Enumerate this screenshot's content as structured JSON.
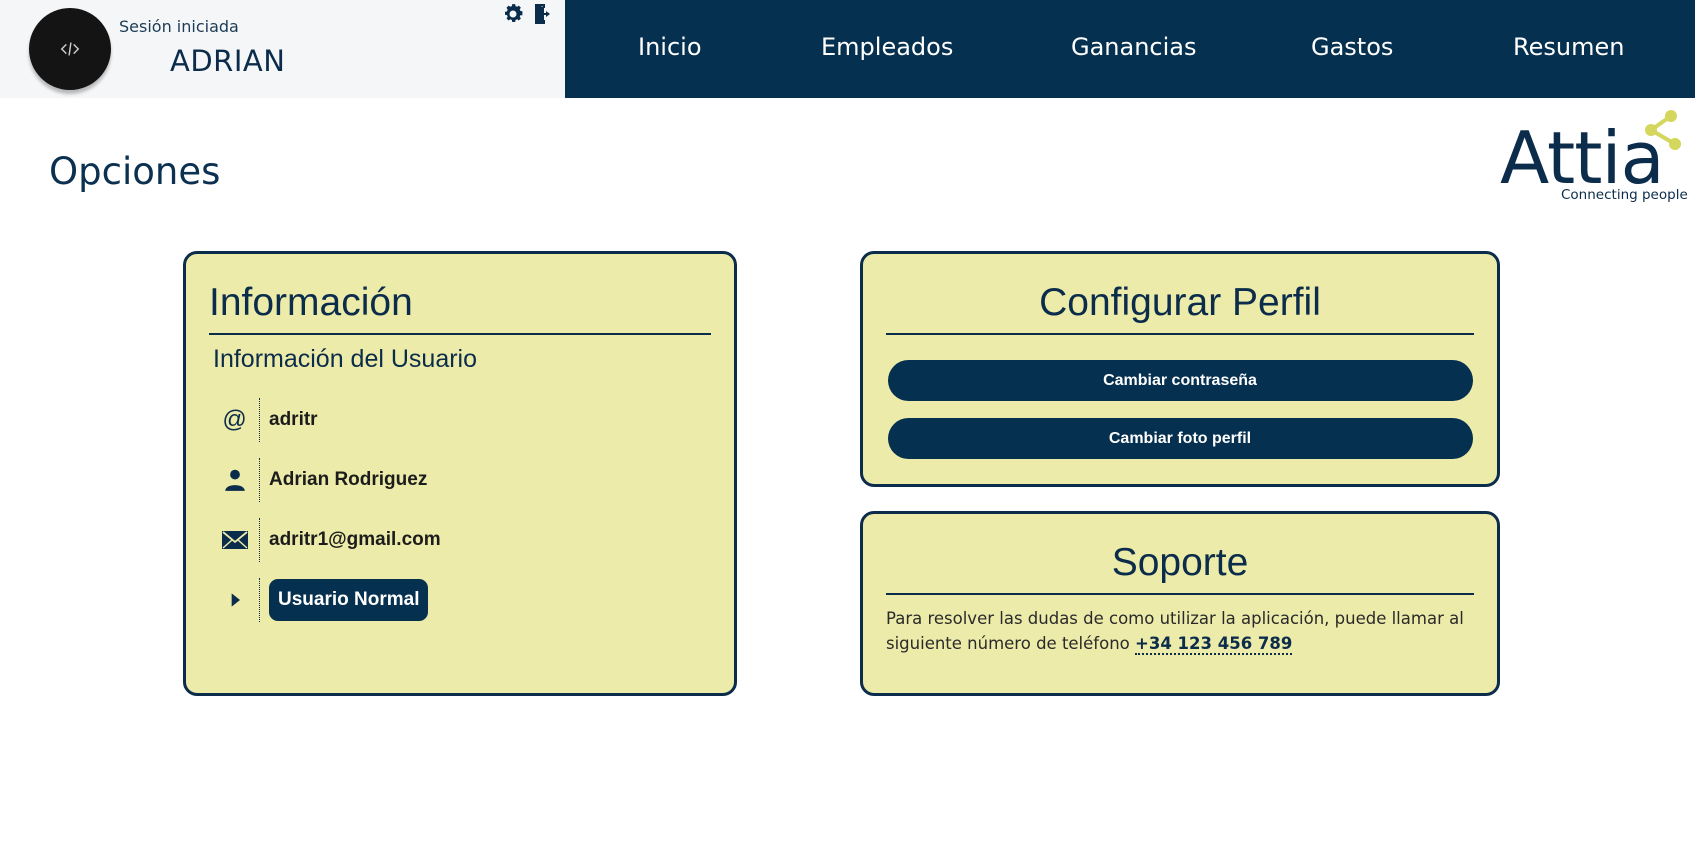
{
  "header": {
    "session_label": "Sesión iniciada",
    "username": "ADRIAN",
    "icons": [
      "settings-icon",
      "logout-icon"
    ]
  },
  "nav": {
    "items": [
      {
        "label": "Inicio"
      },
      {
        "label": "Empleados"
      },
      {
        "label": "Ganancias"
      },
      {
        "label": "Gastos"
      },
      {
        "label": "Resumen"
      }
    ]
  },
  "page": {
    "title": "Opciones"
  },
  "logo": {
    "name": "Attia",
    "tagline": "Connecting people"
  },
  "info_card": {
    "title": "Información",
    "subtitle": "Información del Usuario",
    "username": "adritr",
    "full_name": "Adrian Rodriguez",
    "email": "adritr1@gmail.com",
    "role": "Usuario Normal"
  },
  "profile_card": {
    "title": "Configurar Perfil",
    "change_password": "Cambiar contraseña",
    "change_photo": "Cambiar foto perfil"
  },
  "support_card": {
    "title": "Soporte",
    "text": "Para resolver las dudas de como utilizar la aplicación, puede llamar al siguiente número de teléfono",
    "phone": "+34 123 456 789"
  },
  "colors": {
    "navy": "#06304f",
    "card_bg": "#ecebaa",
    "logo_accent": "#d4d65e"
  }
}
